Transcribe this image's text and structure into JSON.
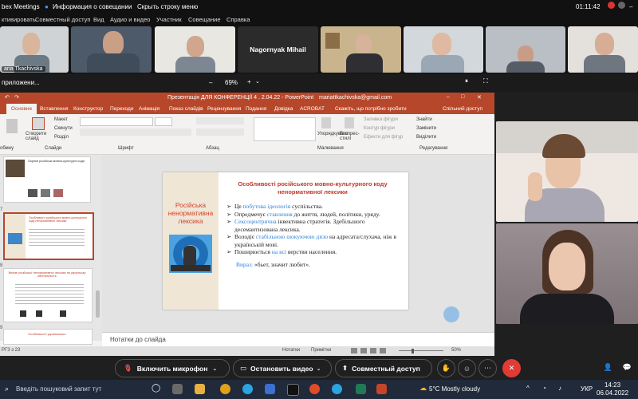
{
  "titlebar": {
    "app": "bex Meetings",
    "info": "Информация о совещании",
    "hide": "Скрыть строку меню",
    "time": "01:11:42"
  },
  "menu": [
    "ктивировать",
    "Совместный доступ",
    "Вид",
    "Аудио и видео",
    "Участник",
    "Совещание",
    "Справка"
  ],
  "participants": [
    {
      "name": "aria Tkachivska"
    },
    {
      "name": ""
    },
    {
      "name": ""
    },
    {
      "name": "Nagornyak Mihail"
    },
    {
      "name": ""
    },
    {
      "name": ""
    },
    {
      "name": ""
    },
    {
      "name": ""
    }
  ],
  "share": {
    "label": "приложени...",
    "zoom": "69%"
  },
  "ppt": {
    "title": "Презентація ДЛЯ КОНФЕРЕНЦІЇ 4 . 2.04.22 - PowerPoint",
    "account": "mariattkachivska@gmail.com",
    "tabs": [
      "Основне",
      "Вставлення",
      "Конструктор",
      "Переходи",
      "Анімація",
      "Показ слайдів",
      "Рецензування",
      "Подання",
      "Довідка",
      "ACROBAT",
      "Скажіть, що потрібно зробити",
      "Спільний доступ"
    ],
    "ribbon": {
      "groups": [
        "обмну",
        "Слайди",
        "Шрифт",
        "Абзац",
        "Малювання",
        "Редагування"
      ],
      "new_slide": "Створити слайд",
      "layout": "Макет",
      "reset": "Скинути",
      "section": "Розділ",
      "find": "Знайти",
      "replace": "Замінити",
      "select": "Виділити",
      "arrange": "Упорядкувати",
      "quick_styles": "Експрес-стилі",
      "fill": "Заливка фігури",
      "outline": "Контур фігури",
      "effects": "Ефекти для фігур"
    },
    "thumb_nums": [
      "",
      "7",
      "8",
      "",
      "9"
    ],
    "thumb_titles": [
      "Окремі російські мовно-культурні коди",
      "Особливості російського мовно-культурного коду ненормативної лексики",
      "Вплив російської ненормативної лексики на українську ментальність",
      "",
      "Особливості українського"
    ],
    "slide": {
      "left_title": "Російська ненормативна лексика",
      "title": "Особливості російського мовно-культурного коду ненормативної лексики",
      "bullets": [
        [
          "Це ",
          "побутова ідеологія",
          " суспільства."
        ],
        [
          "Опредмечує ",
          "ставлення",
          " до життя, людей, політики, уряду."
        ],
        [
          "Сексоцентрична",
          " інвективна стратегія. Здебільшого десемантизована лексика.",
          ""
        ],
        [
          "Володіє ",
          "стабільною шокуючою дією",
          " на адресата/слухача, ніж в українській мові."
        ],
        [
          "Поширюється ",
          "на всі",
          " верстви населення."
        ]
      ],
      "phrase_label": "Вираз:",
      "phrase": " «бьет, значит любит»."
    },
    "notes": "Нотатки до слайда",
    "status_left": "РГ3 з 23",
    "status_notes": "Нотатки",
    "status_comments": "Примітки",
    "status_zoom": "50%"
  },
  "controls": {
    "mic": "Включить микрофон",
    "video": "Остановить видео",
    "share": "Совместный доступ"
  },
  "taskbar": {
    "search": "Введіть пошуковий запит тут",
    "weather": "5°C  Mostly cloudy",
    "lang": "УКР",
    "time": "14:23",
    "date": "06.04.2022"
  },
  "colors": {
    "ppt_accent": "#b7472a",
    "end_call": "#e23a35",
    "highlight": "#2f84d8",
    "slide_title": "#c0392b"
  }
}
